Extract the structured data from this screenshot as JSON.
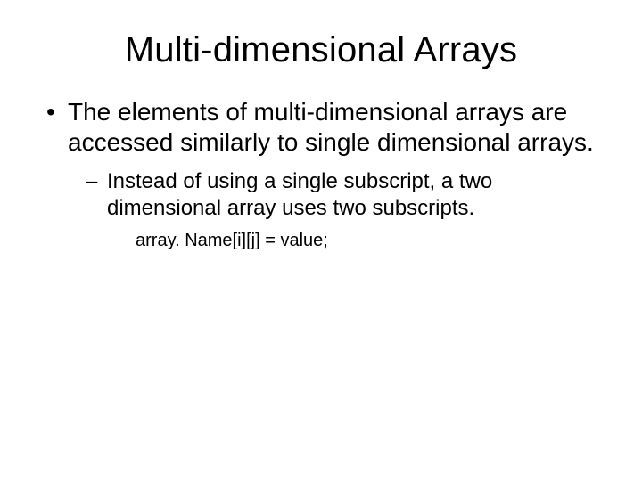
{
  "title": "Multi-dimensional Arrays",
  "bullet1": "The elements of multi-dimensional arrays are accessed similarly to single dimensional arrays.",
  "bullet2": "Instead of using a single subscript, a two dimensional array uses two subscripts.",
  "bullet3": "array. Name[i][j] = value;"
}
